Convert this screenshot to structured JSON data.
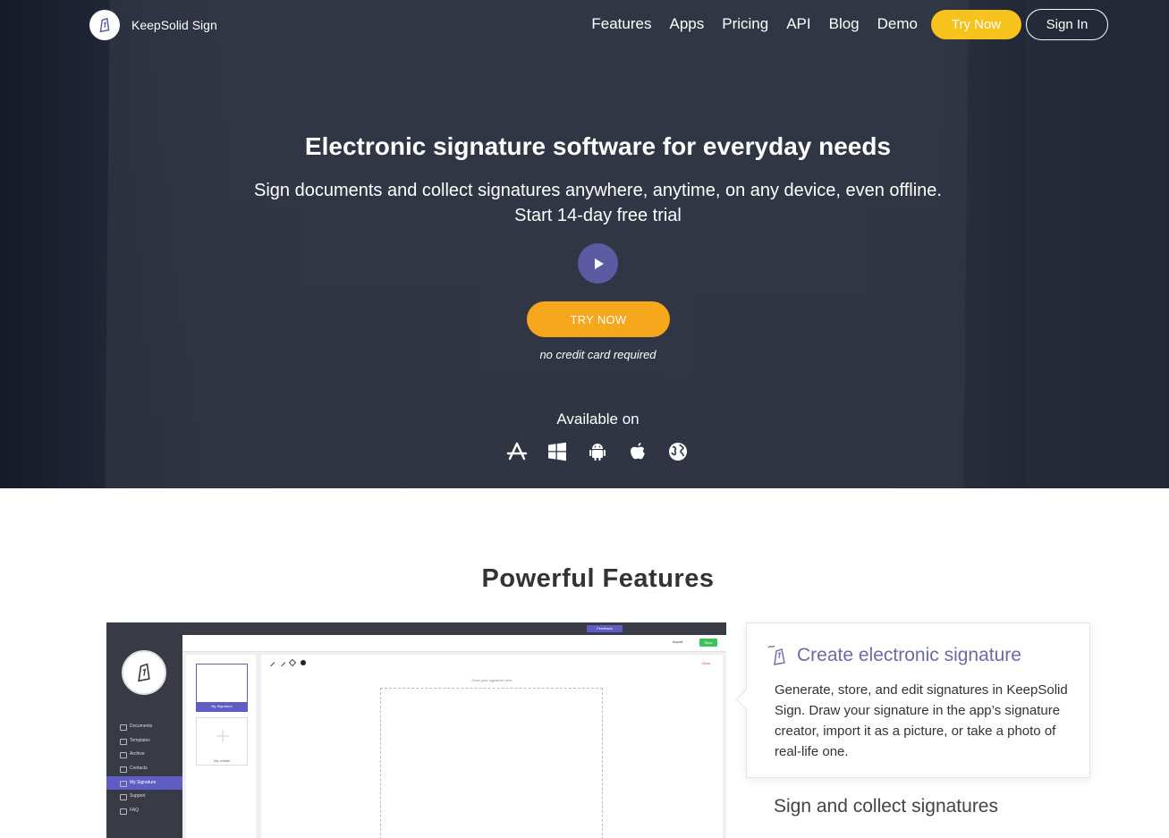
{
  "nav": {
    "brand": "KeepSolid Sign",
    "links": [
      "Features",
      "Apps",
      "Pricing",
      "API",
      "Blog",
      "Demo"
    ],
    "try_now": "Try Now",
    "sign_in": "Sign In"
  },
  "hero": {
    "title": "Electronic signature software for everyday needs",
    "subtitle_line1": "Sign documents and collect signatures anywhere, anytime, on any device, even offline.",
    "subtitle_line2": "Start 14-day free trial",
    "cta": "TRY NOW",
    "note": "no credit card required",
    "available_on": "Available on",
    "platform_icons": [
      "app-store-icon",
      "windows-icon",
      "android-icon",
      "apple-icon",
      "web-globe-icon"
    ]
  },
  "features": {
    "title": "Powerful Features",
    "items": [
      {
        "title": "Create electronic signature",
        "description": "Generate, store, and edit signatures in KeepSolid Sign. Draw your signature in the app’s signature creator, import it as a picture, or take a photo of real-life one."
      },
      {
        "title": "Sign and collect signatures"
      }
    ]
  },
  "app_screenshot": {
    "menu": [
      "Documents",
      "Templates",
      "Archive",
      "Contacts",
      "My Signature",
      "Support",
      "FAQ"
    ],
    "active_menu": "My Signature",
    "card_signature": "My Signature",
    "card_initials": "My Initials",
    "canvas_hint": "Draw your signature here",
    "feedback": "Feedback",
    "import": "Import",
    "save": "Save",
    "clear": "Clear"
  },
  "colors": {
    "accent_yellow": "#f7c21b",
    "accent_orange": "#f7a71b",
    "purple": "#5b5aa3",
    "feature_title": "#6c6aa9"
  }
}
